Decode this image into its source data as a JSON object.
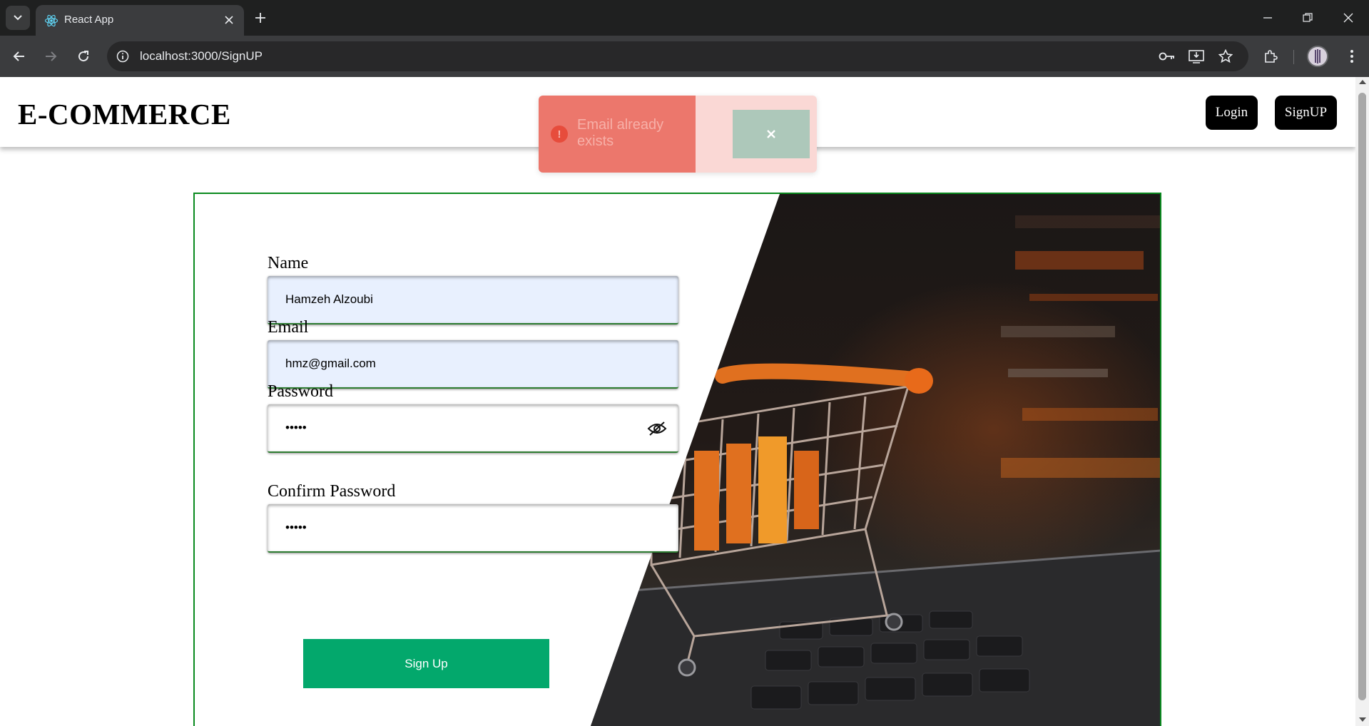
{
  "browser": {
    "tab_title": "React App",
    "url": "localhost:3000/SignUP",
    "icons": [
      "tab-list-icon",
      "react-icon",
      "close-icon",
      "plus-icon",
      "minimize-icon",
      "restore-icon",
      "window-close-icon",
      "back-icon",
      "forward-icon",
      "reload-icon",
      "site-info-icon",
      "key-icon",
      "install-icon",
      "star-icon",
      "extensions-icon",
      "profile-avatar",
      "menu-icon"
    ]
  },
  "header": {
    "brand": "E-COMMERCE",
    "login_label": "Login",
    "signup_label": "SignUP"
  },
  "toast": {
    "message": "Email already exists",
    "close_glyph": "✕",
    "icon_glyph": "!",
    "colors": {
      "left": "#ec776c",
      "right": "#fad8d5",
      "close_bg": "#adc8ba"
    }
  },
  "form": {
    "name_label": "Name",
    "name_value": "Hamzeh Alzoubi",
    "email_label": "Email",
    "email_value": "hmz@gmail.com",
    "password_label": "Password",
    "password_value": "•••••",
    "confirm_label": "Confirm Password",
    "confirm_value": "•••••",
    "submit_label": "Sign Up",
    "colors": {
      "autofill_bg": "#e8f0fe",
      "submit_bg": "#03a86c",
      "card_border": "#0a8a1f"
    }
  }
}
